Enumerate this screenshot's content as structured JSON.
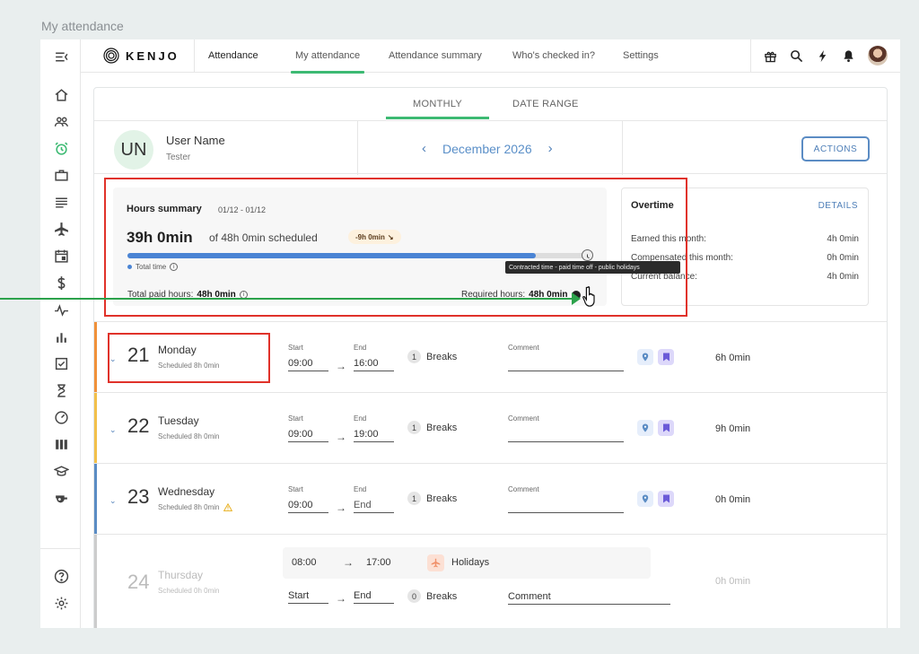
{
  "page_label": "My attendance",
  "brand": {
    "logo_text": "KENJO"
  },
  "nav": {
    "tabs": [
      "Attendance",
      "My attendance",
      "Attendance summary",
      "Who's checked in?",
      "Settings"
    ]
  },
  "icons": {
    "sidebar": [
      "collapse-menu-icon",
      "home-icon",
      "people-icon",
      "alarm-clock-icon",
      "briefcase-icon",
      "list-icon",
      "airplane-icon",
      "calendar-icon",
      "dollar-icon",
      "pulse-icon",
      "bar-chart-icon",
      "checklist-icon",
      "hourglass-icon",
      "gauge-icon",
      "columns-icon",
      "graduation-cap-icon",
      "whistle-icon",
      "help-icon",
      "settings-icon"
    ],
    "top": [
      "gift-icon",
      "search-icon",
      "lightning-icon",
      "bell-icon",
      "avatar"
    ]
  },
  "view_tabs": [
    "MONTHLY",
    "DATE RANGE"
  ],
  "user": {
    "initials": "UN",
    "name": "User Name",
    "role": "Tester"
  },
  "period": {
    "label": "December 2026"
  },
  "actions_label": "ACTIONS",
  "hours_summary": {
    "title": "Hours summary",
    "range": "01/12 - 01/12",
    "worked": "39h 0min",
    "of_scheduled": "of 48h 0min scheduled",
    "difference": "-9h 0min",
    "legend": "Total time",
    "progress_fraction": 0.88,
    "paid_label": "Total paid hours:",
    "paid_value": "48h 0min",
    "required_label": "Required hours:",
    "required_value": "48h 0min",
    "tooltip": "Contracted time - paid time off - public holidays"
  },
  "overtime": {
    "title": "Overtime",
    "details_label": "DETAILS",
    "rows": [
      {
        "label": "Earned this month:",
        "value": "4h 0min"
      },
      {
        "label": "Compensated this month:",
        "value": "0h 0min"
      },
      {
        "label": "Current balance:",
        "value": "4h 0min"
      }
    ]
  },
  "days": [
    {
      "num": "21",
      "name": "Monday",
      "scheduled": "Scheduled 8h 0min",
      "start_label": "Start",
      "end_label": "End",
      "start": "09:00",
      "end": "16:00",
      "breaks_count": "1",
      "breaks_label": "Breaks",
      "comment_label": "Comment",
      "total": "6h 0min",
      "bar_color": "#f0913a"
    },
    {
      "num": "22",
      "name": "Tuesday",
      "scheduled": "Scheduled 8h 0min",
      "start_label": "Start",
      "end_label": "End",
      "start": "09:00",
      "end": "19:00",
      "breaks_count": "1",
      "breaks_label": "Breaks",
      "comment_label": "Comment",
      "total": "9h 0min",
      "bar_color": "#f2c04a"
    },
    {
      "num": "23",
      "name": "Wednesday",
      "scheduled": "Scheduled 8h 0min",
      "start_label": "Start",
      "end_label": "End",
      "start": "09:00",
      "end": "End",
      "breaks_count": "1",
      "breaks_label": "Breaks",
      "comment_label": "Comment",
      "total": "0h 0min",
      "bar_color": "#5b8cc4"
    },
    {
      "num": "24",
      "name": "Thursday",
      "scheduled": "Scheduled 0h 0min",
      "holiday_start": "08:00",
      "holiday_end": "17:00",
      "holiday_label": "Holidays",
      "start": "Start",
      "end": "End",
      "breaks_count": "0",
      "breaks_label": "Breaks",
      "comment": "Comment",
      "total": "0h 0min",
      "bar_color": "#cccccc"
    }
  ],
  "arrow_symbol": "→"
}
